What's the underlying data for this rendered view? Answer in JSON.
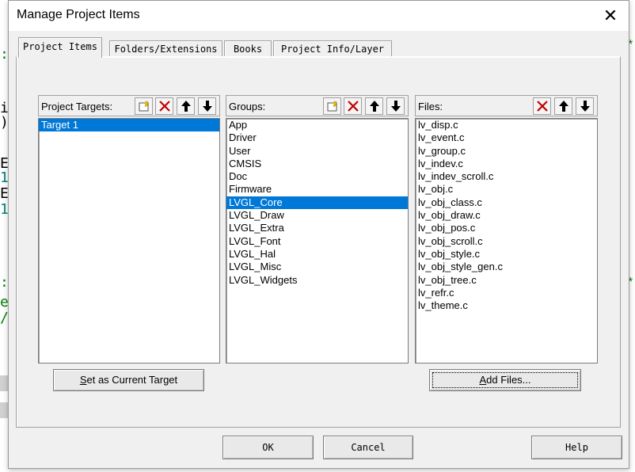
{
  "window": {
    "title": "Manage Project Items"
  },
  "tabs": [
    {
      "label": "Project Items"
    },
    {
      "label": "Folders/Extensions"
    },
    {
      "label": "Books"
    },
    {
      "label": "Project Info/Layer"
    }
  ],
  "targets": {
    "label": "Project Targets:",
    "items": [
      "Target 1"
    ],
    "selected": 0
  },
  "groups": {
    "label": "Groups:",
    "items": [
      "App",
      "Driver",
      "User",
      "CMSIS",
      "Doc",
      "Firmware",
      "LVGL_Core",
      "LVGL_Draw",
      "LVGL_Extra",
      "LVGL_Font",
      "LVGL_Hal",
      "LVGL_Misc",
      "LVGL_Widgets"
    ],
    "selected": 6
  },
  "files": {
    "label": "Files:",
    "items": [
      "lv_disp.c",
      "lv_event.c",
      "lv_group.c",
      "lv_indev.c",
      "lv_indev_scroll.c",
      "lv_obj.c",
      "lv_obj_class.c",
      "lv_obj_draw.c",
      "lv_obj_pos.c",
      "lv_obj_scroll.c",
      "lv_obj_style.c",
      "lv_obj_style_gen.c",
      "lv_obj_tree.c",
      "lv_refr.c",
      "lv_theme.c"
    ]
  },
  "buttons": {
    "set_current": {
      "accel": "S",
      "rest": "et as Current Target"
    },
    "add_files": {
      "accel": "A",
      "rest": "dd Files..."
    },
    "ok": "OK",
    "cancel": "Cancel",
    "help": "Help"
  },
  "colors": {
    "selection": "#0078d7",
    "delete_icon": "#c00000",
    "dialog_bg": "#f0f0f0"
  }
}
